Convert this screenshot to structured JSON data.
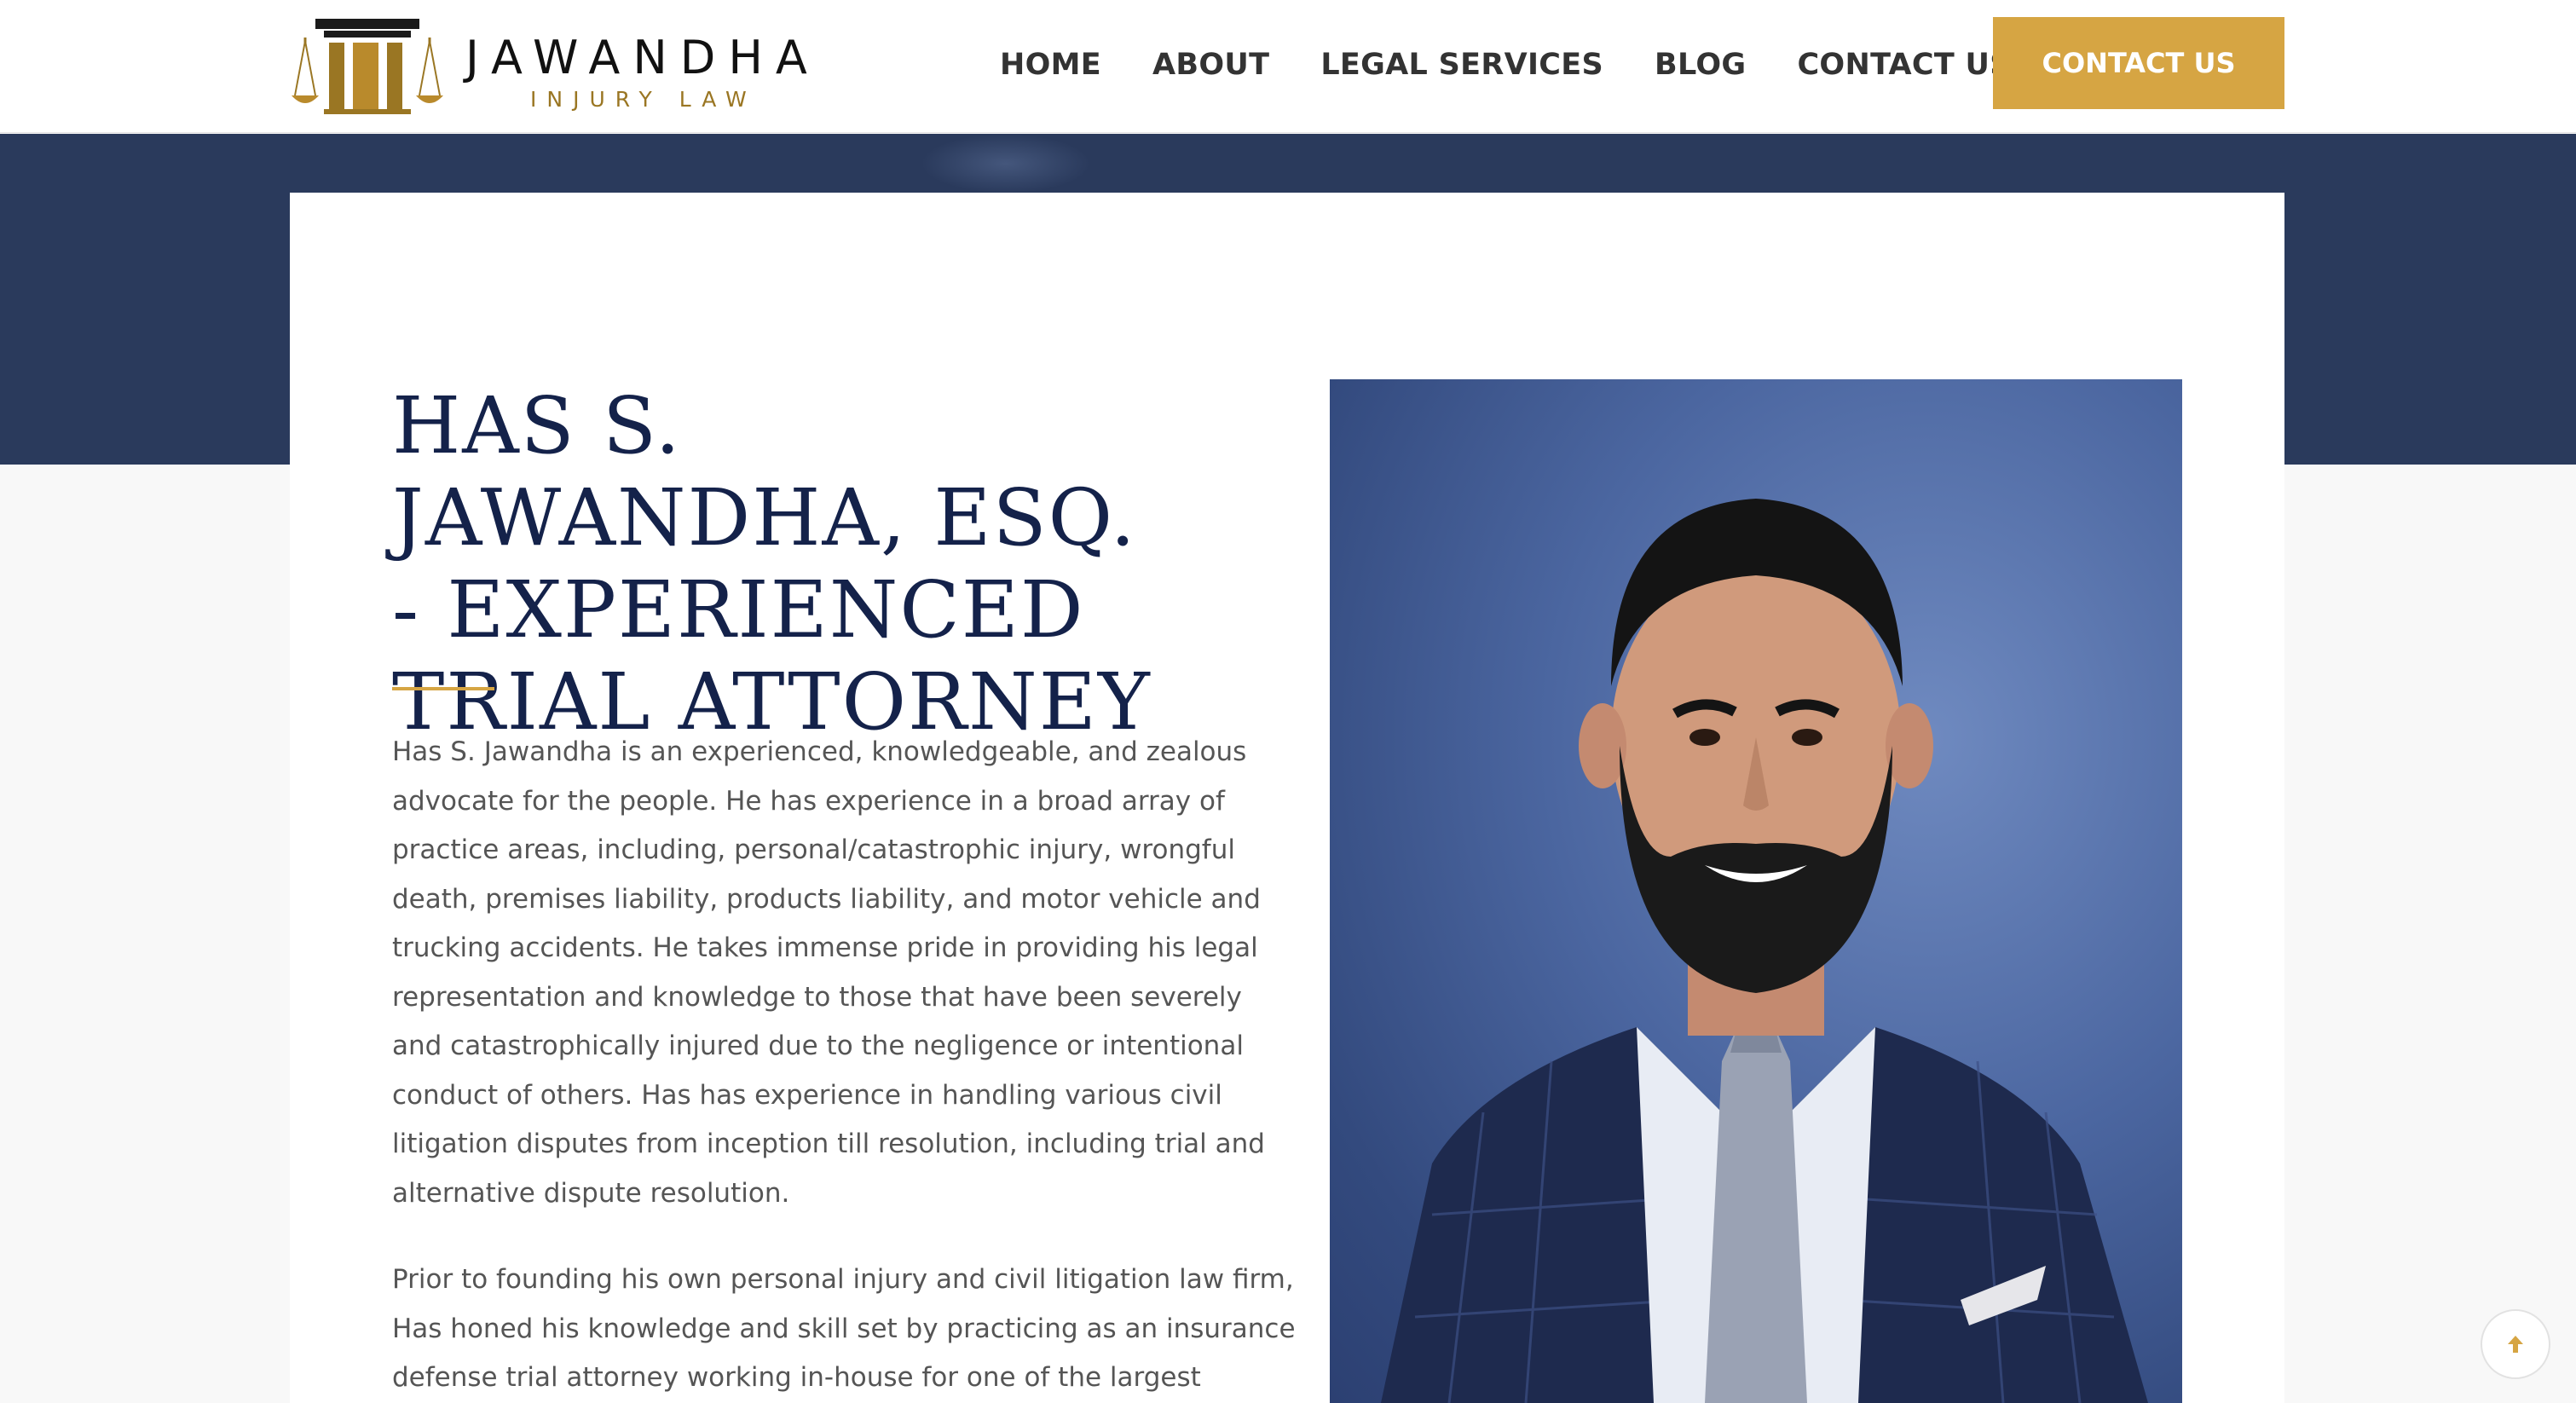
{
  "brand": {
    "name": "JAWANDHA",
    "subtitle": "INJURY LAW",
    "gold": "#d6a543",
    "navy": "#14224a",
    "band": "#2a3a5c"
  },
  "nav": {
    "items": [
      {
        "label": "HOME"
      },
      {
        "label": "ABOUT"
      },
      {
        "label": "LEGAL SERVICES"
      },
      {
        "label": "BLOG"
      },
      {
        "label": "CONTACT US"
      }
    ],
    "cta_label": "CONTACT US"
  },
  "main": {
    "heading": "HAS S. JAWANDHA, ESQ. - EXPERIENCED TRIAL ATTORNEY",
    "paragraphs": [
      "Has S. Jawandha is an experienced, knowledgeable, and zealous advocate for the people. He has experience in a broad array of practice areas, including, personal/catastrophic injury, wrongful death, premises liability, products liability, and motor vehicle and trucking accidents. He takes immense pride in providing his legal representation and knowledge to those that have been severely and catastrophically injured due to the negligence or intentional conduct of others. Has has experience in handling various civil litigation disputes from inception till resolution, including trial and alternative dispute resolution.",
      "Prior to founding his own personal injury and civil litigation law firm, Has honed his knowledge and skill set by practicing as an insurance defense trial attorney working in-house for one of the largest"
    ]
  },
  "icons": {
    "logo": "scales-pillar-logo",
    "scroll_top": "arrow-up-icon"
  }
}
